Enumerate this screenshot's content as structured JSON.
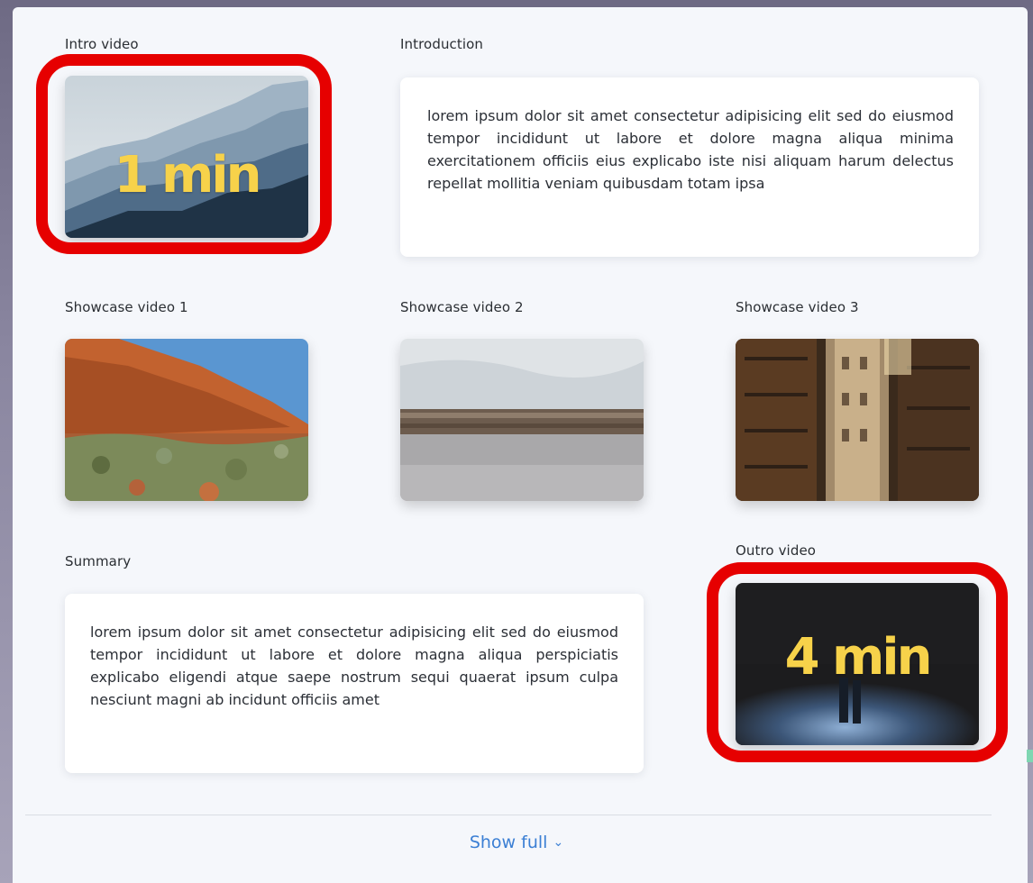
{
  "intro": {
    "title": "Intro video",
    "duration": "1 min"
  },
  "introduction": {
    "title": "Introduction",
    "text": "lorem ipsum dolor sit amet consectetur adipisicing elit sed do eiusmod tempor incididunt ut labore et dolore magna aliqua minima exercitationem officiis eius explicabo iste nisi aliquam harum delectus repellat mollitia veniam quibusdam totam ipsa"
  },
  "showcase": [
    {
      "title": "Showcase video 1"
    },
    {
      "title": "Showcase video 2"
    },
    {
      "title": "Showcase video 3"
    }
  ],
  "summary": {
    "title": "Summary",
    "text": "lorem ipsum dolor sit amet consectetur adipisicing elit sed do eiusmod tempor incididunt ut labore et dolore magna aliqua perspiciatis explicabo eligendi atque saepe nostrum sequi quaerat ipsum culpa nesciunt magni ab incidunt officiis amet"
  },
  "outro": {
    "title": "Outro video",
    "duration": "4 min"
  },
  "footer": {
    "show_full_label": "Show full",
    "chevron_icon": "chevron-down-icon"
  },
  "colors": {
    "highlight": "#e60000",
    "duration_text": "#f7d24a",
    "link": "#3b7fd4"
  }
}
